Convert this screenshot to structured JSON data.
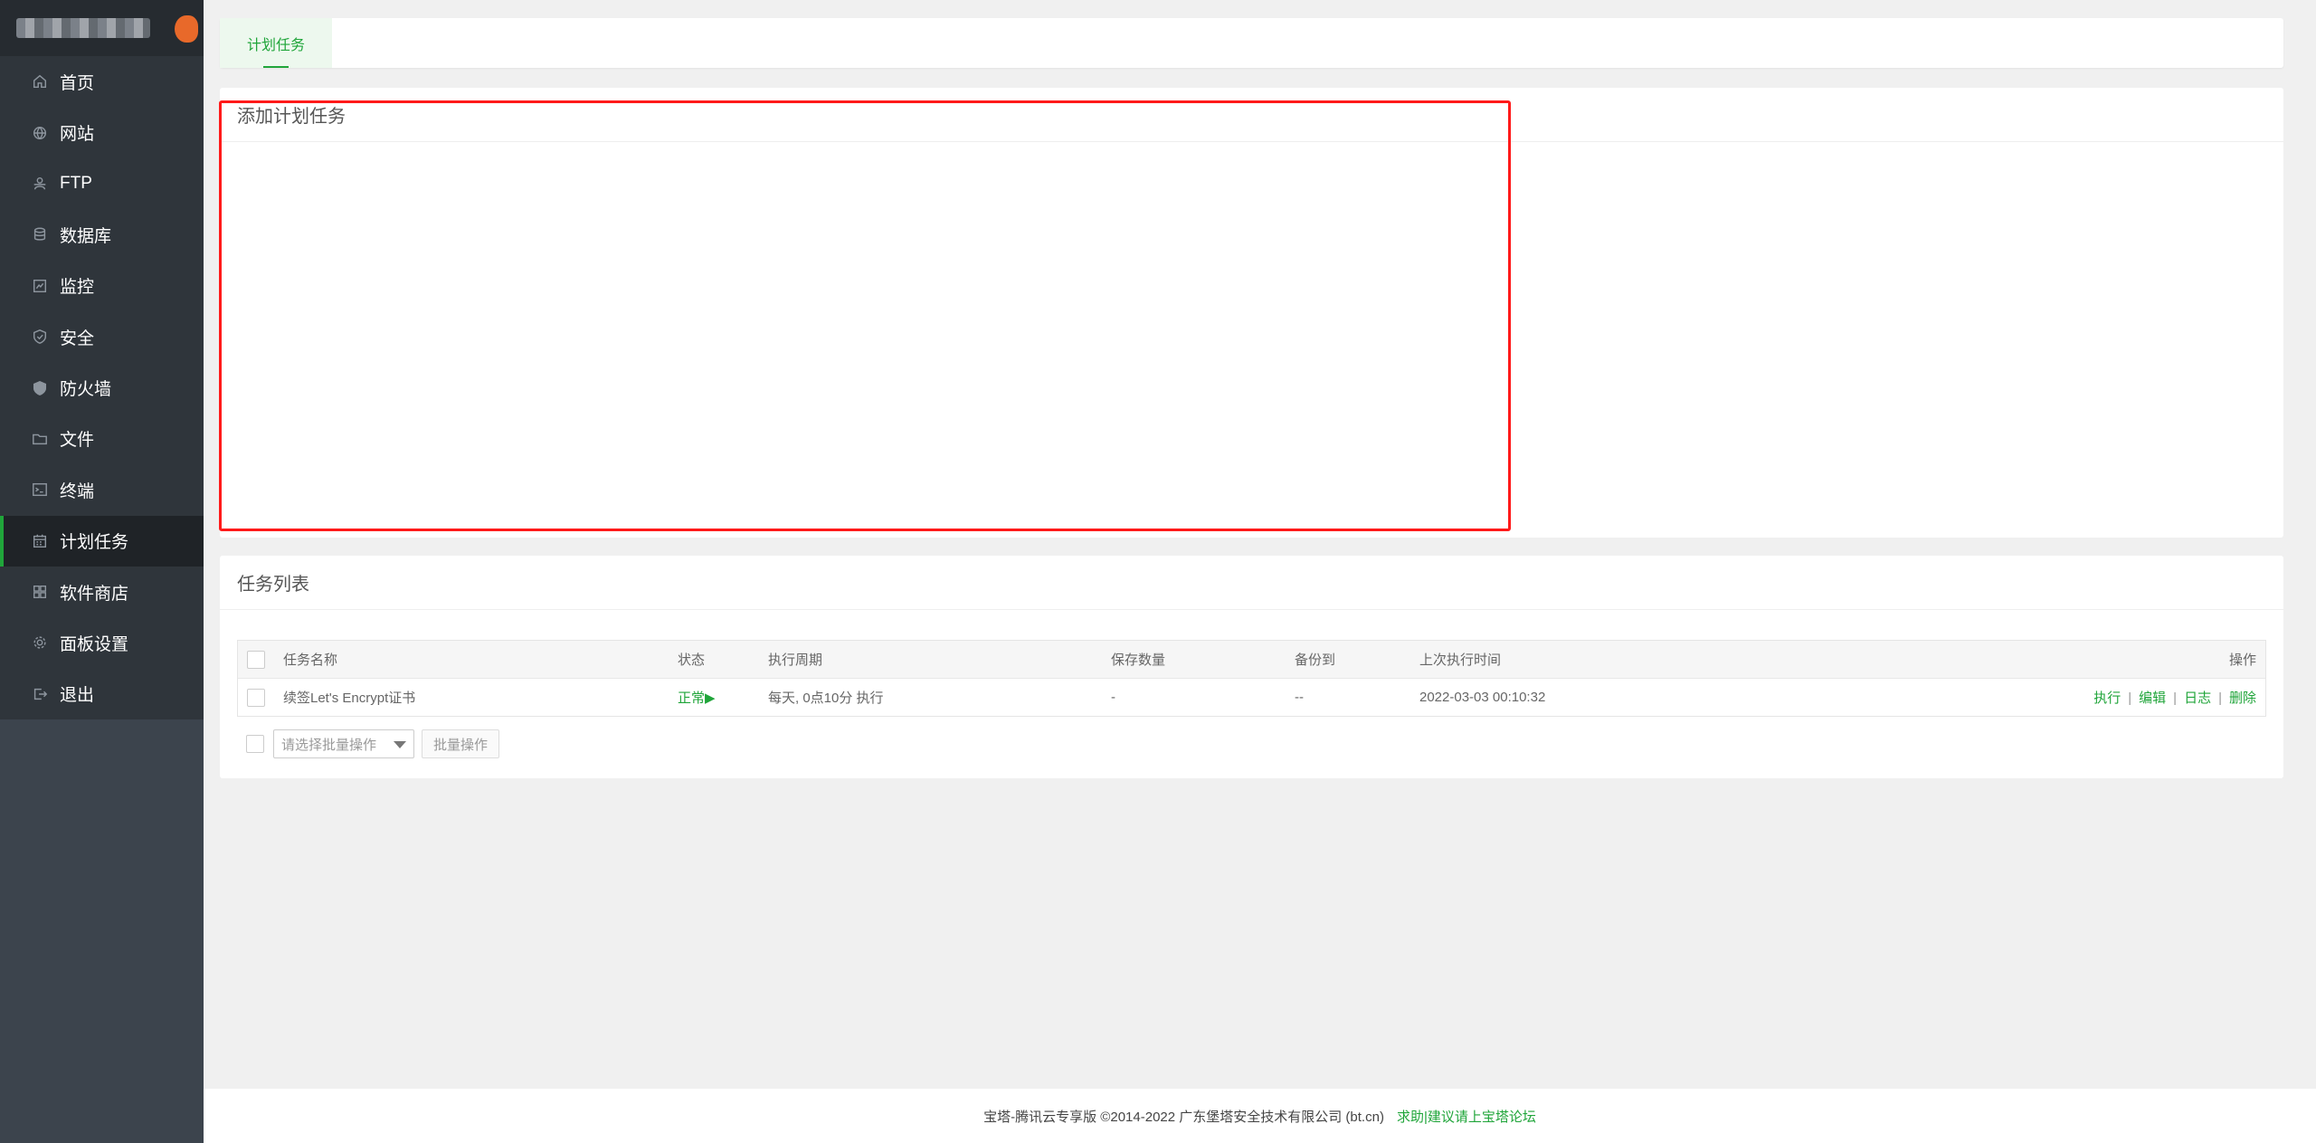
{
  "sidebar": {
    "items": [
      {
        "label": "首页",
        "icon": "home-icon"
      },
      {
        "label": "网站",
        "icon": "globe-icon"
      },
      {
        "label": "FTP",
        "icon": "ftp-icon"
      },
      {
        "label": "数据库",
        "icon": "database-icon"
      },
      {
        "label": "监控",
        "icon": "monitor-icon"
      },
      {
        "label": "安全",
        "icon": "shield-check-icon"
      },
      {
        "label": "防火墙",
        "icon": "firewall-icon"
      },
      {
        "label": "文件",
        "icon": "folder-icon"
      },
      {
        "label": "终端",
        "icon": "terminal-icon"
      },
      {
        "label": "计划任务",
        "icon": "calendar-icon",
        "active": true
      },
      {
        "label": "软件商店",
        "icon": "grid-icon"
      },
      {
        "label": "面板设置",
        "icon": "gear-icon"
      },
      {
        "label": "退出",
        "icon": "logout-icon"
      }
    ]
  },
  "tabbar": {
    "active_tab": "计划任务"
  },
  "add_panel": {
    "title": "添加计划任务"
  },
  "list_panel": {
    "title": "任务列表",
    "columns": [
      "任务名称",
      "状态",
      "执行周期",
      "保存数量",
      "备份到",
      "上次执行时间",
      "操作"
    ],
    "rows": [
      {
        "name": "续签Let's Encrypt证书",
        "status": "正常▶",
        "cycle": "每天, 0点10分 执行",
        "keep": "-",
        "backup": "--",
        "last_run": "2022-03-03 00:10:32",
        "ops": [
          "执行",
          "编辑",
          "日志",
          "删除"
        ]
      }
    ],
    "batch_select_placeholder": "请选择批量操作",
    "batch_button": "批量操作"
  },
  "footer": {
    "copyright": "宝塔-腾讯云专享版 ©2014-2022 广东堡塔安全技术有限公司 (bt.cn)",
    "link": "求助|建议请上宝塔论坛"
  },
  "colors": {
    "accent": "#20a53a",
    "highlight_border": "#ff1a1a",
    "sidebar_bg": "#3c444d"
  }
}
